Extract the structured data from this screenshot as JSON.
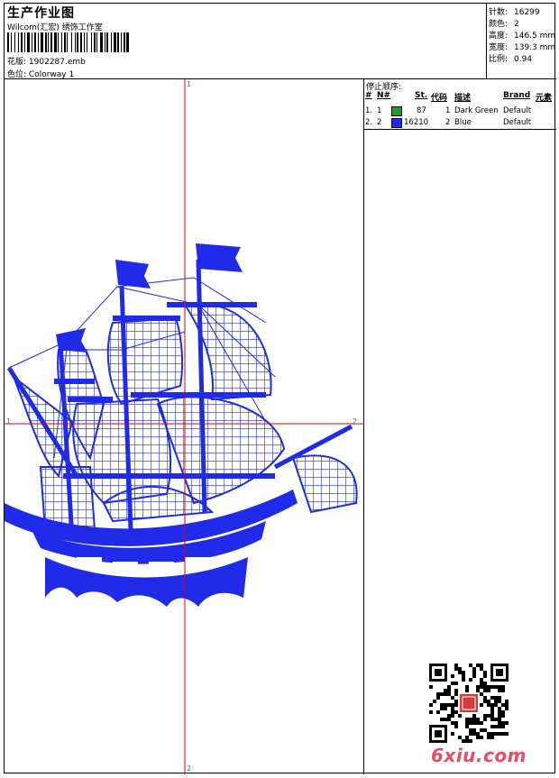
{
  "header": {
    "title": "生产作业图",
    "company": "Wilcom(汇宏) 绣饰工作室",
    "design_label": "花版:",
    "design_value": "1902287.emb",
    "color_label": "色位:",
    "color_value": "Colorway 1"
  },
  "stats": [
    {
      "label": "针数:",
      "value": "16299"
    },
    {
      "label": "颜色:",
      "value": "2"
    },
    {
      "label": "高度:",
      "value": "146.5 mm"
    },
    {
      "label": "宽度:",
      "value": "139.3 mm"
    },
    {
      "label": "比例:",
      "value": "0.94"
    }
  ],
  "stop_sequence": {
    "title": "停止顺序:",
    "headers": {
      "num": "#",
      "needle": "N#",
      "stitches": "St.",
      "code": "代码",
      "desc": "描述",
      "brand": "Brand",
      "element": "元素"
    },
    "rows": [
      {
        "num": "1.",
        "needle": "1",
        "color": "#1f9c2a",
        "stitches": "87",
        "code": "1",
        "desc": "Dark Green",
        "brand": "Default"
      },
      {
        "num": "2.",
        "needle": "2",
        "color": "#1f2be8",
        "stitches": "16210",
        "code": "2",
        "desc": "Blue",
        "brand": "Default"
      }
    ]
  },
  "axes": {
    "top": "1",
    "bottom": "2",
    "left": "1",
    "right": "2"
  },
  "watermark": "6xiu.com",
  "colors": {
    "thread_blue": "#1f2be8",
    "crosshair": "#e00000",
    "axis_label": "#1a9c1a"
  }
}
